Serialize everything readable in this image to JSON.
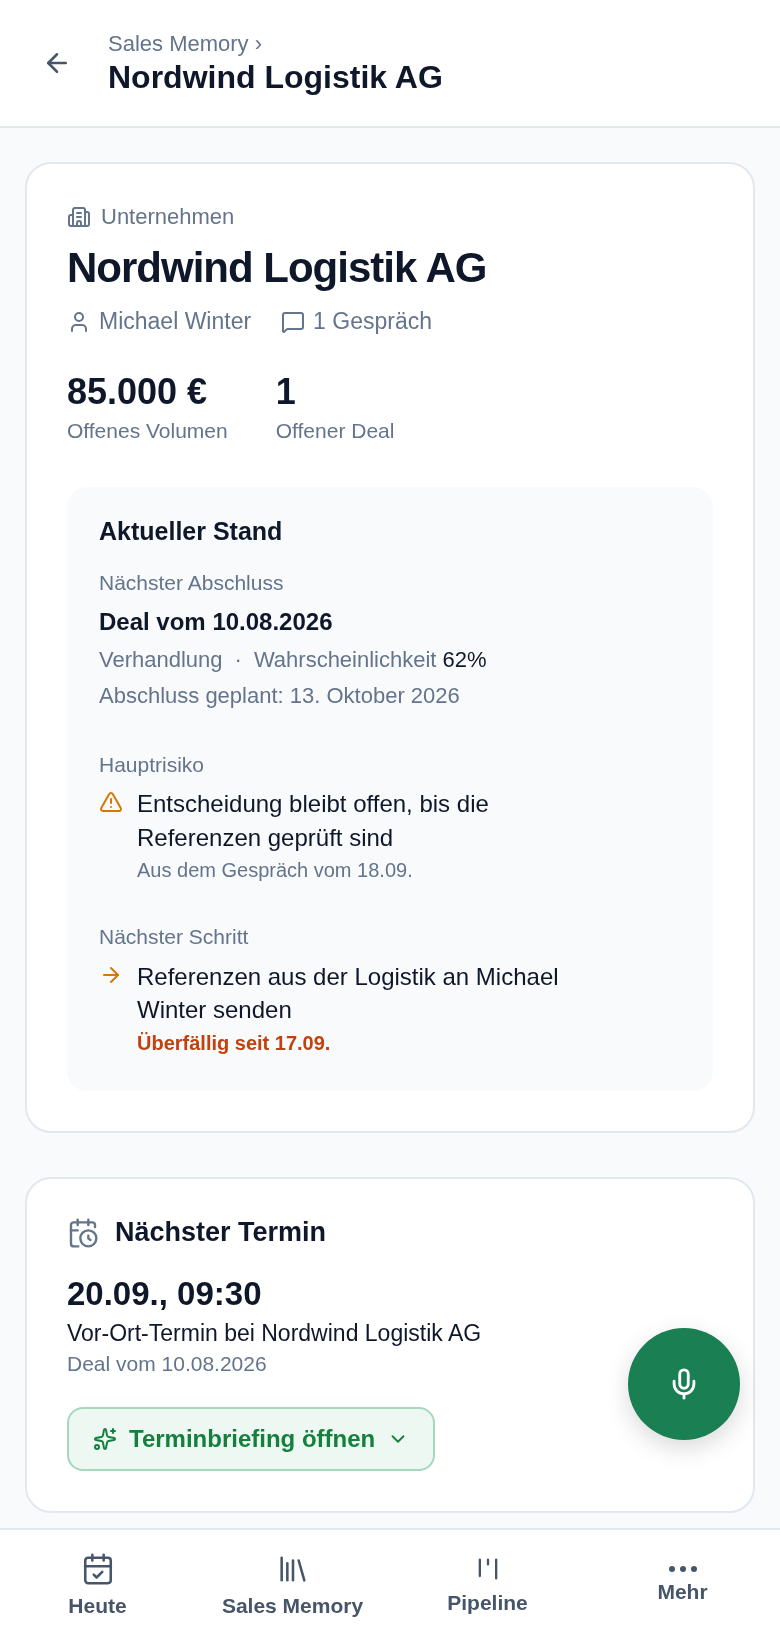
{
  "header": {
    "breadcrumb": "Sales Memory ›",
    "title": "Nordwind Logistik AG"
  },
  "company": {
    "type_label": "Unternehmen",
    "name": "Nordwind Logistik AG",
    "contact": "Michael Winter",
    "conversations": "1 Gespräch",
    "stats": [
      {
        "value": "85.000 €",
        "label": "Offenes Volumen"
      },
      {
        "value": "1",
        "label": "Offener Deal"
      }
    ],
    "status": {
      "title": "Aktueller Stand",
      "next_close": {
        "label": "Nächster Abschluss",
        "deal": "Deal vom 10.08.2026",
        "stage": "Verhandlung",
        "separator": "·",
        "probability_label": "Wahrscheinlichkeit",
        "probability": "62%",
        "planned": "Abschluss geplant: 13. Oktober 2026"
      },
      "risk": {
        "label": "Hauptrisiko",
        "text": "Entscheidung bleibt offen, bis die Referenzen geprüft sind",
        "source": "Aus dem Gespräch vom 18.09."
      },
      "next_step": {
        "label": "Nächster Schritt",
        "text": "Referenzen aus der Logistik an Michael Winter senden",
        "note": "Überfällig seit 17.09."
      }
    }
  },
  "appointment": {
    "title": "Nächster Termin",
    "time": "20.09., 09:30",
    "description": "Vor-Ort-Termin bei Nordwind Logistik AG",
    "deal": "Deal vom 10.08.2026",
    "button": "Terminbriefing öffnen"
  },
  "nav": [
    {
      "kind": "calendar",
      "label": "Heute"
    },
    {
      "kind": "library",
      "label": "Sales Memory"
    },
    {
      "kind": "pipeline",
      "label": "Pipeline"
    },
    {
      "kind": "more",
      "label": "Mehr"
    }
  ]
}
